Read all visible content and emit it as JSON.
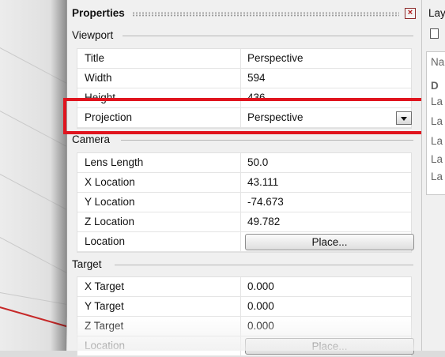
{
  "panel": {
    "title": "Properties",
    "close_icon": "close-icon",
    "sections": {
      "viewport": {
        "label": "Viewport",
        "rows": [
          {
            "label": "Title",
            "value": "Perspective"
          },
          {
            "label": "Width",
            "value": "594"
          },
          {
            "label": "Height",
            "value": "436"
          }
        ],
        "projection": {
          "label": "Projection",
          "value": "Perspective"
        }
      },
      "camera": {
        "label": "Camera",
        "rows": [
          {
            "label": "Lens Length",
            "value": "50.0"
          },
          {
            "label": "X Location",
            "value": "43.111"
          },
          {
            "label": "Y Location",
            "value": "-74.673"
          },
          {
            "label": "Z Location",
            "value": "49.782"
          }
        ],
        "location": {
          "label": "Location",
          "button": "Place..."
        }
      },
      "target": {
        "label": "Target",
        "rows": [
          {
            "label": "X Target",
            "value": "0.000"
          },
          {
            "label": "Y Target",
            "value": "0.000"
          },
          {
            "label": "Z Target",
            "value": "0.000"
          }
        ],
        "location": {
          "label": "Location",
          "button": "Place..."
        }
      }
    }
  },
  "layers": {
    "title": "Lay",
    "column": "Na",
    "items": [
      "D",
      "La",
      "La",
      "La",
      "La",
      "La"
    ]
  },
  "colors": {
    "highlight": "#e0141e",
    "axis": "#c62828"
  }
}
